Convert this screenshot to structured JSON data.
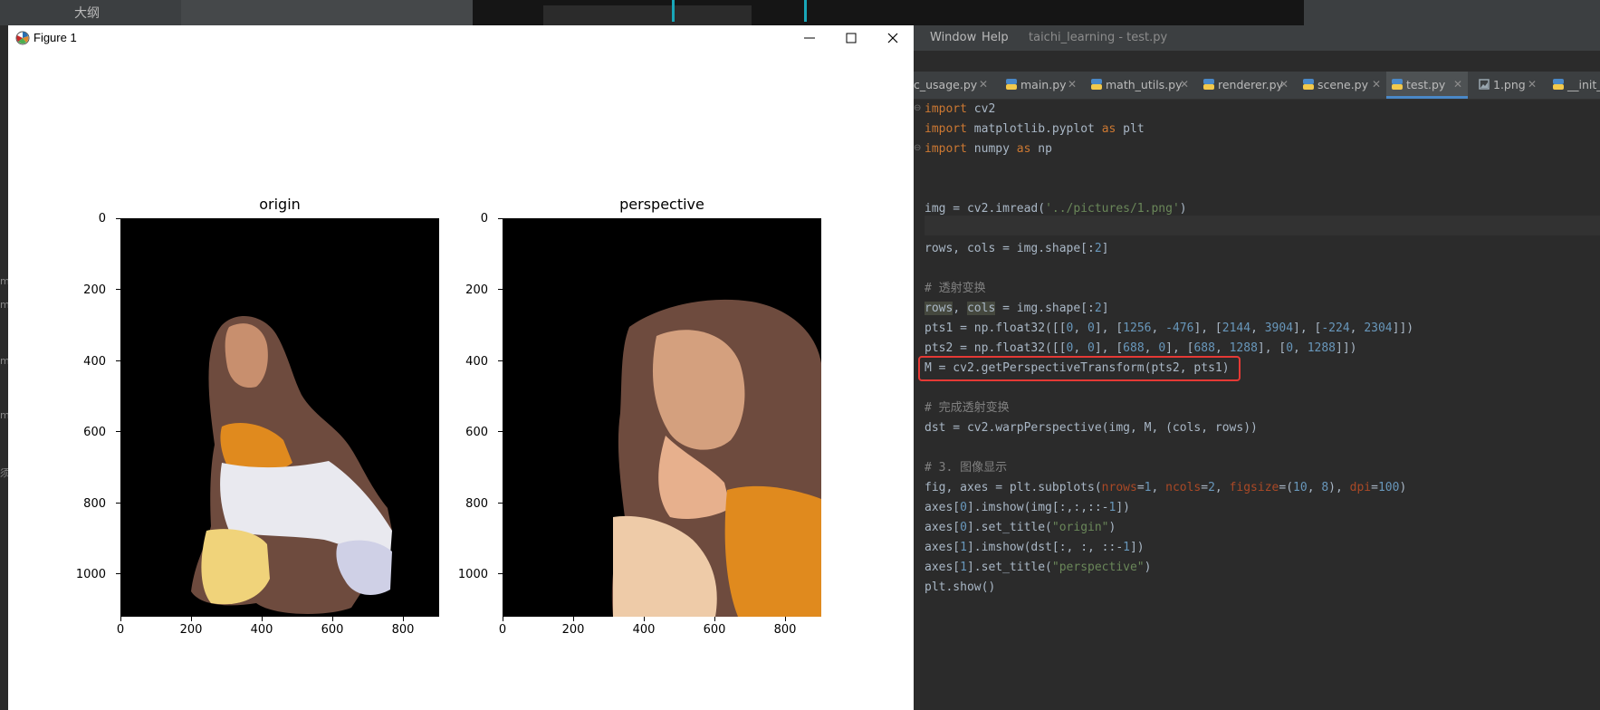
{
  "background": {
    "outline_label": "大纲",
    "left_strip_letters": [
      "m",
      "m",
      "m",
      "m",
      "须"
    ]
  },
  "figure_window": {
    "title": "Figure 1",
    "controls": {
      "minimize": "minimize-icon",
      "maximize": "maximize-icon",
      "close": "close-icon"
    }
  },
  "chart_data": [
    {
      "type": "image",
      "title": "origin",
      "xlabel": "",
      "ylabel": "",
      "xlim": [
        0,
        900
      ],
      "ylim": [
        1120,
        0
      ],
      "xticks": [
        "0",
        "200",
        "400",
        "600",
        "800"
      ],
      "yticks": [
        "0",
        "200",
        "400",
        "600",
        "800",
        "1000"
      ],
      "x_tick_values": [
        0,
        200,
        400,
        600,
        800
      ],
      "y_tick_values": [
        0,
        200,
        400,
        600,
        800,
        1000
      ],
      "grid": false
    },
    {
      "type": "image",
      "title": "perspective",
      "xlabel": "",
      "ylabel": "",
      "xlim": [
        0,
        900
      ],
      "ylim": [
        1120,
        0
      ],
      "xticks": [
        "0",
        "200",
        "400",
        "600",
        "800"
      ],
      "yticks": [
        "0",
        "200",
        "400",
        "600",
        "800",
        "1000"
      ],
      "x_tick_values": [
        0,
        200,
        400,
        600,
        800
      ],
      "y_tick_values": [
        0,
        200,
        400,
        600,
        800,
        1000
      ],
      "grid": false
    }
  ],
  "ide": {
    "menu": [
      "Window",
      "Help"
    ],
    "project_title": "taichi_learning - test.py",
    "tabs": [
      {
        "label": "c_usage.py",
        "active": false
      },
      {
        "label": "main.py",
        "active": false
      },
      {
        "label": "math_utils.py",
        "active": false
      },
      {
        "label": "renderer.py",
        "active": false
      },
      {
        "label": "scene.py",
        "active": false
      },
      {
        "label": "test.py",
        "active": true
      },
      {
        "label": "1.png",
        "active": false
      },
      {
        "label": "__init__",
        "active": false
      }
    ],
    "code_lines": [
      "import cv2",
      "import matplotlib.pyplot as plt",
      "import numpy as np",
      "",
      "",
      "img = cv2.imread('../pictures/1.png')",
      "",
      "rows, cols = img.shape[:2]",
      "",
      "# 透射变换",
      "rows, cols = img.shape[:2]",
      "pts1 = np.float32([[0, 0], [1256, -476], [2144, 3904], [-224, 2304]])",
      "pts2 = np.float32([[0, 0], [688, 0], [688, 1288], [0, 1288]])",
      "M = cv2.getPerspectiveTransform(pts2, pts1)",
      "",
      "# 完成透射变换",
      "dst = cv2.warpPerspective(img, M, (cols, rows))",
      "",
      "# 3. 图像显示",
      "fig, axes = plt.subplots(nrows=1, ncols=2, figsize=(10, 8), dpi=100)",
      "axes[0].imshow(img[:,:,::-1])",
      "axes[0].set_title(\"origin\")",
      "axes[1].imshow(dst[:, :, ::-1])",
      "axes[1].set_title(\"perspective\")",
      "plt.show()"
    ],
    "highlighted_line": 13,
    "colors": {
      "keyword": "#cc7832",
      "string": "#6a8759",
      "number": "#6897bb",
      "comment": "#808080",
      "param": "#aa4926",
      "highlight_box": "#e53935"
    }
  }
}
